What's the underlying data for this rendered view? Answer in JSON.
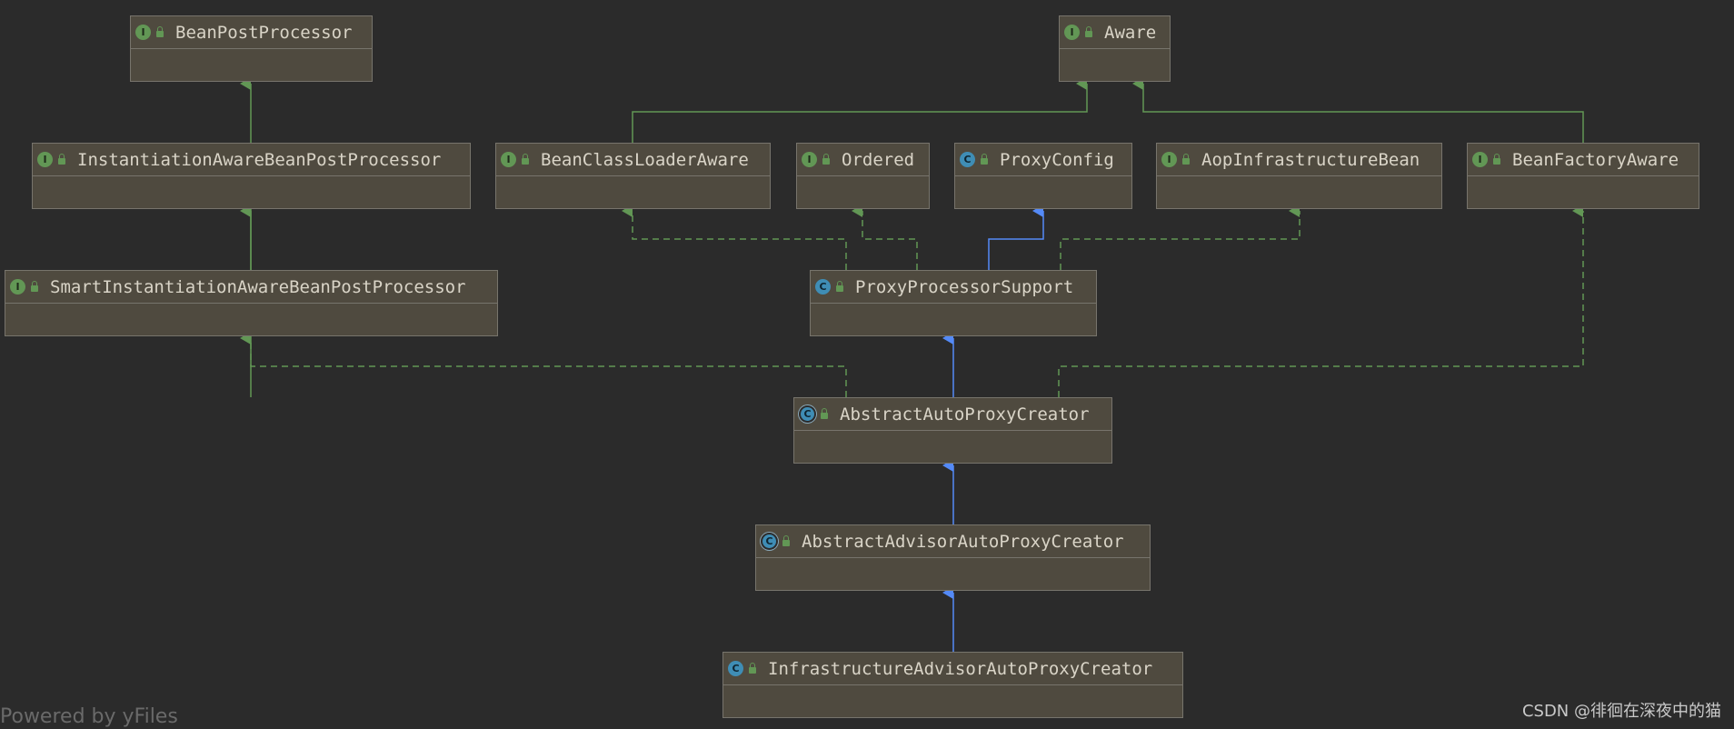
{
  "diagram": {
    "nodes": [
      {
        "id": "bpp",
        "name": "BeanPostProcessor",
        "kind": "interface",
        "kind_letter": "I"
      },
      {
        "id": "aware",
        "name": "Aware",
        "kind": "interface",
        "kind_letter": "I"
      },
      {
        "id": "iabpp",
        "name": "InstantiationAwareBeanPostProcessor",
        "kind": "interface",
        "kind_letter": "I"
      },
      {
        "id": "bcla",
        "name": "BeanClassLoaderAware",
        "kind": "interface",
        "kind_letter": "I"
      },
      {
        "id": "ordered",
        "name": "Ordered",
        "kind": "interface",
        "kind_letter": "I"
      },
      {
        "id": "pconfig",
        "name": "ProxyConfig",
        "kind": "class",
        "kind_letter": "C"
      },
      {
        "id": "aib",
        "name": "AopInfrastructureBean",
        "kind": "interface",
        "kind_letter": "I"
      },
      {
        "id": "bfa",
        "name": "BeanFactoryAware",
        "kind": "interface",
        "kind_letter": "I"
      },
      {
        "id": "siabpp",
        "name": "SmartInstantiationAwareBeanPostProcessor",
        "kind": "interface",
        "kind_letter": "I"
      },
      {
        "id": "pps",
        "name": "ProxyProcessorSupport",
        "kind": "class",
        "kind_letter": "C"
      },
      {
        "id": "aapc",
        "name": "AbstractAutoProxyCreator",
        "kind": "abstract",
        "kind_letter": "C"
      },
      {
        "id": "aaapc",
        "name": "AbstractAdvisorAutoProxyCreator",
        "kind": "abstract",
        "kind_letter": "C"
      },
      {
        "id": "iaapc",
        "name": "InfrastructureAdvisorAutoProxyCreator",
        "kind": "class",
        "kind_letter": "C"
      }
    ],
    "edges": [
      {
        "from": "iabpp",
        "to": "bpp",
        "type": "extends-interface"
      },
      {
        "from": "siabpp",
        "to": "iabpp",
        "type": "extends-interface"
      },
      {
        "from": "bcla",
        "to": "aware",
        "type": "extends-interface"
      },
      {
        "from": "bfa",
        "to": "aware",
        "type": "extends-interface"
      },
      {
        "from": "pps",
        "to": "bcla",
        "type": "implements"
      },
      {
        "from": "pps",
        "to": "ordered",
        "type": "implements"
      },
      {
        "from": "pps",
        "to": "pconfig",
        "type": "extends-class"
      },
      {
        "from": "pps",
        "to": "aib",
        "type": "implements"
      },
      {
        "from": "aapc",
        "to": "siabpp",
        "type": "implements"
      },
      {
        "from": "aapc",
        "to": "pps",
        "type": "extends-class"
      },
      {
        "from": "aapc",
        "to": "bfa",
        "type": "implements"
      },
      {
        "from": "aaapc",
        "to": "aapc",
        "type": "extends-class"
      },
      {
        "from": "iaapc",
        "to": "aaapc",
        "type": "extends-class"
      }
    ],
    "colors": {
      "background": "#2b2b2b",
      "node_fill": "#4f4a3f",
      "node_border": "#77746c",
      "interface_edge": "#629755",
      "class_edge": "#548af7",
      "node_text": "#d9d4c7"
    }
  },
  "footer": {
    "powered_by": "Powered by yFiles",
    "watermark": "CSDN @徘徊在深夜中的猫"
  }
}
